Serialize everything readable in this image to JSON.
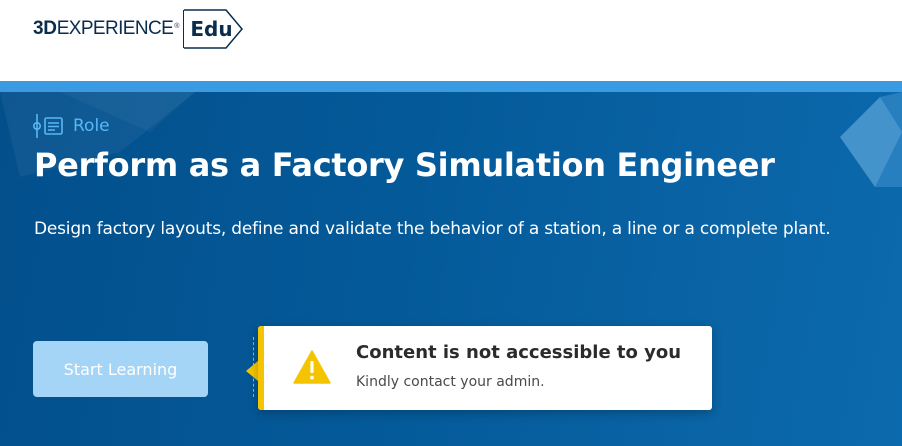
{
  "header": {
    "logo": {
      "brand_bold": "3D",
      "brand_rest": "EXPERIENCE",
      "registered": "®",
      "suffix": "Edu"
    }
  },
  "hero": {
    "type_icon": "role-icon",
    "type_label": "Role",
    "title": "Perform as a Factory Simulation Engineer",
    "description": "Design factory layouts, define and validate the behavior of a station, a line or a complete plant.",
    "start_button_label": "Start Learning"
  },
  "notification": {
    "icon": "warning-icon",
    "title": "Content is not accessible to you",
    "message": "Kindly contact your admin.",
    "accent_color": "#f5c400"
  },
  "colors": {
    "hero_background": "#045a99",
    "accent_stripe": "#3a9ae2",
    "role_label": "#58b8f5",
    "button_background": "#a4d5f7"
  }
}
